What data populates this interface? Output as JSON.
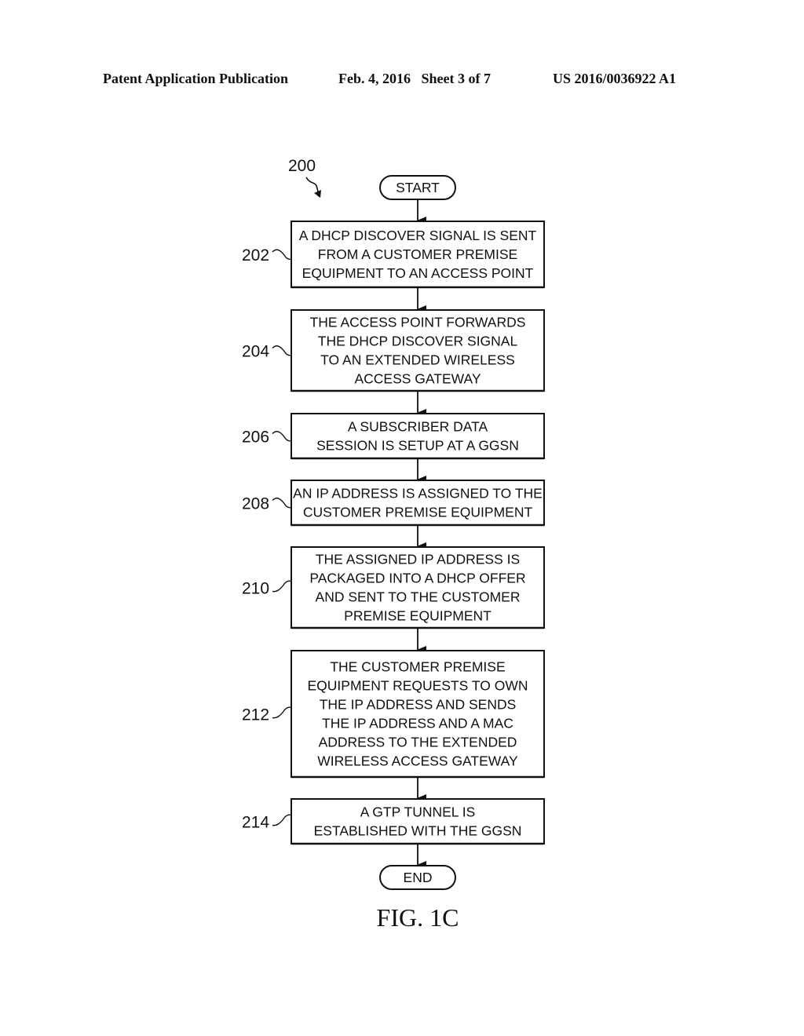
{
  "header": {
    "publication_label": "Patent Application Publication",
    "date_sheet": "Feb. 4, 2016   Sheet 3 of 7",
    "patent_number": "US 2016/0036922 A1"
  },
  "figure": {
    "ref_number": "200",
    "caption": "FIG. 1C",
    "start_label": "START",
    "end_label": "END",
    "steps": [
      {
        "ref": "202",
        "lines": [
          "A DHCP DISCOVER SIGNAL IS SENT",
          "FROM A CUSTOMER PREMISE",
          "EQUIPMENT TO AN ACCESS POINT"
        ]
      },
      {
        "ref": "204",
        "lines": [
          "THE ACCESS POINT FORWARDS",
          "THE DHCP DISCOVER SIGNAL",
          "TO AN EXTENDED WIRELESS",
          "ACCESS GATEWAY"
        ]
      },
      {
        "ref": "206",
        "lines": [
          "A SUBSCRIBER DATA",
          "SESSION IS SETUP AT A GGSN"
        ]
      },
      {
        "ref": "208",
        "lines": [
          "AN IP ADDRESS IS ASSIGNED TO THE",
          "CUSTOMER PREMISE EQUIPMENT"
        ]
      },
      {
        "ref": "210",
        "lines": [
          "THE ASSIGNED IP ADDRESS IS",
          "PACKAGED INTO A DHCP OFFER",
          "AND SENT TO THE CUSTOMER",
          "PREMISE EQUIPMENT"
        ]
      },
      {
        "ref": "212",
        "lines": [
          "THE CUSTOMER PREMISE",
          "EQUIPMENT REQUESTS TO OWN",
          "THE IP ADDRESS AND SENDS",
          "THE IP ADDRESS AND A MAC",
          "ADDRESS TO THE EXTENDED",
          "WIRELESS ACCESS GATEWAY"
        ]
      },
      {
        "ref": "214",
        "lines": [
          "A GTP TUNNEL IS",
          "ESTABLISHED WITH THE GGSN"
        ]
      }
    ]
  }
}
